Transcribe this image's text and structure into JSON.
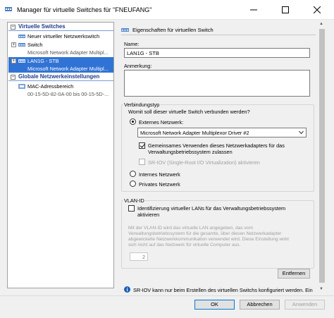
{
  "window": {
    "title": "Manager für virtuelle Switches für \"FNEUFANG\""
  },
  "tree": {
    "header_switches": "Virtuelle Switches",
    "new_switch": "Neuer virtueller Netzwerkswitch",
    "switches": [
      {
        "name": "Switch",
        "adapter": "Microsoft Network Adapter Multipl..."
      },
      {
        "name": "LAN1G - STB",
        "adapter": "Microsoft Network Adapter Multipl..."
      }
    ],
    "header_global": "Globale Netzwerkeinstellungen",
    "mac_title": "MAC-Adressbereich",
    "mac_range": "00-15-5D-82-0A-00 bis 00-15-5D-..."
  },
  "props": {
    "header": "Eigenschaften für virtuellen Switch",
    "name_label": "Name:",
    "name_value": "LAN1G - STB",
    "note_label": "Anmerkung:",
    "note_value": "",
    "conn": {
      "group_title": "Verbindungstyp",
      "question": "Womit soll dieser virtuelle Switch verbunden werden?",
      "external_label": "Externes Netzwerk:",
      "adapter_selected": "Microsoft Network Adapter Multiplexor Driver #2",
      "share_line1": "Gemeinsames Verwenden dieses Netzwerkadapters für das",
      "share_line2": "Verwaltungsbetriebssystem zulassen",
      "sriov_label": "SR-IOV (Single-Root I/O Virtualization) aktivieren",
      "internal_label": "Internes Netzwerk",
      "private_label": "Privates Netzwerk"
    },
    "vlan": {
      "group_title": "VLAN-ID",
      "check_line1": "Identifizierung virtueller LANs für das Verwaltungsbetriebssystem",
      "check_line2": "aktivieren",
      "desc_line1": "Mit der VLAN-ID wird das virtuelle LAN angegeben, das vom",
      "desc_line2": "Verwaltungsbetriebssystem für die gesamte, über diesen Netzwerkadapter",
      "desc_line3": "abgewickelte Netzwerkkommunikation verwendet wird. Diese Einstellung wirkt",
      "desc_line4": "sich nicht auf das Netzwerk für virtuelle Computer aus.",
      "vlan_value": "2"
    },
    "remove_button": "Entfernen",
    "info_text": "SR-IOV kann nur beim Erstellen des virtuellen Switchs konfiguriert werden. Ein"
  },
  "footer": {
    "ok": "OK",
    "cancel": "Abbrechen",
    "apply": "Anwenden"
  },
  "colors": {
    "selection": "#3173d4",
    "header_text": "#1f3b8f",
    "accent": "#0078d7"
  }
}
